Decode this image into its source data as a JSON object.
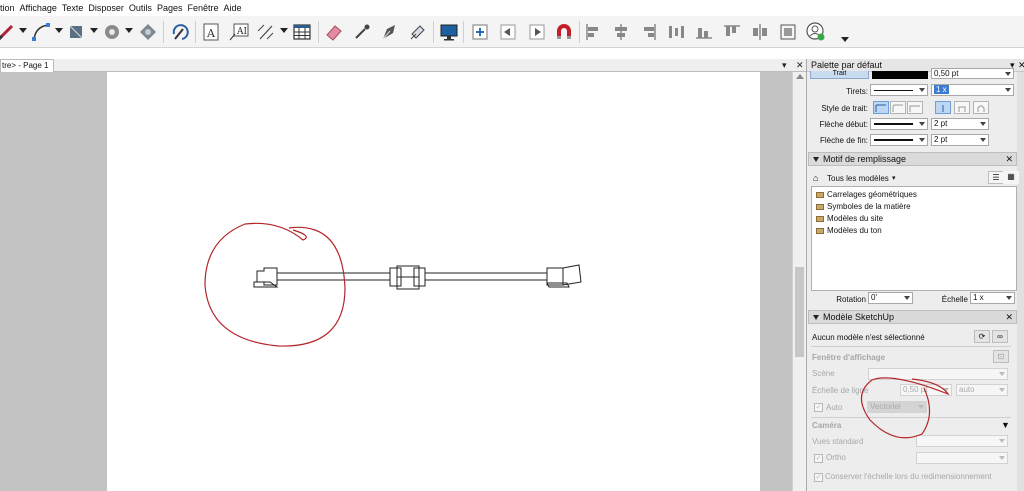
{
  "menubar": {
    "items": [
      "tion",
      "Affichage",
      "Texte",
      "Disposer",
      "Outils",
      "Pages",
      "Fenêtre",
      "Aide"
    ]
  },
  "toolbar": {
    "icons": [
      "pencil-icon",
      "arc-icon",
      "shape-icon",
      "offset-icon",
      "follow-me-icon",
      "rotate-icon",
      "text-icon",
      "label-icon",
      "dimension-icon",
      "table-icon",
      "eraser-icon",
      "eyedropper-icon",
      "style-icon",
      "split-icon",
      "presentation-icon",
      "add-page-icon",
      "previous-page-icon",
      "next-page-icon",
      "magnet-icon",
      "align-left-icon",
      "align-center-icon",
      "align-right-icon",
      "distribute-h-icon",
      "align-top-icon",
      "align-middle-icon",
      "align-bottom-icon",
      "flip-icon",
      "account-icon"
    ]
  },
  "document": {
    "tab_label": "tre> - Page 1"
  },
  "tray": {
    "title": "Palette par défaut",
    "stroke": {
      "trait_label": "Trait",
      "trait_size": "0,50 pt",
      "dash_label": "Tirets:",
      "dash_scale": "1 x",
      "style_label": "Style de trait:",
      "start_label": "Flèche début:",
      "start_size": "2 pt",
      "end_label": "Flèche de fin:",
      "end_size": "2 pt"
    },
    "pattern": {
      "title": "Motif de remplissage",
      "collection": "Tous les modèles",
      "items": [
        "Carrelages géométriques",
        "Symboles de la matière",
        "Modèles du site",
        "Modèles du ton"
      ],
      "rotation_label": "Rotation",
      "rotation_value": "0'",
      "scale_label": "Échelle",
      "scale_value": "1 x"
    },
    "sketchup": {
      "title": "Modèle SketchUp",
      "status": "Aucun modèle n'est sélectionné",
      "viewport_label": "Fenêtre d'affichage",
      "scene_label": "Scène",
      "line_scale_label": "Échelle de ligne",
      "line_scale_value": "0,50 pt",
      "line_scale_mode": "auto",
      "auto_label": "Auto",
      "render_mode": "Vectoriel",
      "camera_label": "Caméra",
      "standard_views_label": "Vues standard",
      "ortho_label": "Ortho",
      "preserve_label": "Conserver l'échelle lors du redimensionnement"
    }
  },
  "colors": {
    "annotation": "#b4252a",
    "accent": "#3d7bd0"
  }
}
